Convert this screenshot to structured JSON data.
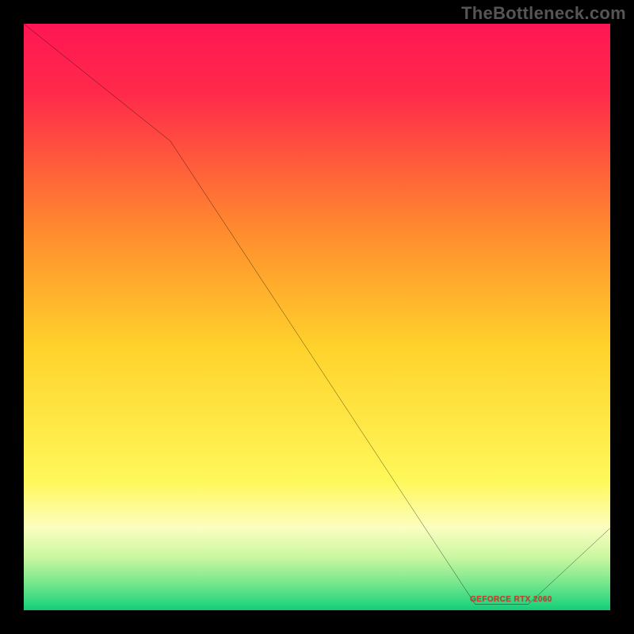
{
  "attribution": "TheBottleneck.com",
  "marker_label": "GEFORCE RTX 2060",
  "chart_data": {
    "type": "line",
    "title": "",
    "xlabel": "",
    "ylabel": "",
    "xlim": [
      0,
      100
    ],
    "ylim": [
      0,
      100
    ],
    "x": [
      0,
      25,
      77,
      86,
      100
    ],
    "values": [
      100,
      80,
      1,
      1,
      14
    ],
    "marker_segment": {
      "x_start": 77,
      "x_end": 86,
      "y": 1
    },
    "gradient_stops": [
      {
        "pos": 0,
        "color": "#ff1654"
      },
      {
        "pos": 12,
        "color": "#ff2a4a"
      },
      {
        "pos": 35,
        "color": "#ff8a2e"
      },
      {
        "pos": 55,
        "color": "#ffd22b"
      },
      {
        "pos": 78,
        "color": "#fff85a"
      },
      {
        "pos": 86,
        "color": "#fbfec0"
      },
      {
        "pos": 91,
        "color": "#c9f7a0"
      },
      {
        "pos": 95,
        "color": "#7ee88e"
      },
      {
        "pos": 99,
        "color": "#27d67f"
      },
      {
        "pos": 100,
        "color": "#18c873"
      }
    ]
  }
}
